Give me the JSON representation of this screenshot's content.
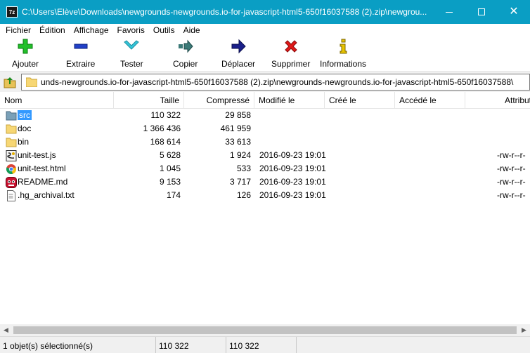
{
  "window": {
    "title": "C:\\Users\\Elève\\Downloads\\newgrounds-newgrounds.io-for-javascript-html5-650f16037588 (2).zip\\newgrou...",
    "app_icon_text": "7z",
    "accent": "#0a9ec4"
  },
  "menu": [
    "Fichier",
    "Édition",
    "Affichage",
    "Favoris",
    "Outils",
    "Aide"
  ],
  "toolbar": [
    {
      "label": "Ajouter",
      "icon": "add-icon"
    },
    {
      "label": "Extraire",
      "icon": "extract-icon"
    },
    {
      "label": "Tester",
      "icon": "test-icon"
    },
    {
      "label": "Copier",
      "icon": "copy-icon"
    },
    {
      "label": "Déplacer",
      "icon": "move-icon"
    },
    {
      "label": "Supprimer",
      "icon": "delete-icon"
    },
    {
      "label": "Informations",
      "icon": "info-icon"
    }
  ],
  "address": {
    "path": "unds-newgrounds.io-for-javascript-html5-650f16037588 (2).zip\\newgrounds-newgrounds.io-for-javascript-html5-650f16037588\\"
  },
  "columns": [
    "Nom",
    "Taille",
    "Compressé",
    "Modifié le",
    "Créé le",
    "Accédé le",
    "Attribut"
  ],
  "files": [
    {
      "name": "src",
      "size": "110 322",
      "packed": "29 858",
      "modified": "",
      "created": "",
      "accessed": "",
      "attr": "",
      "type": "folder-icon",
      "selected": true
    },
    {
      "name": "doc",
      "size": "1 366 436",
      "packed": "461 959",
      "modified": "",
      "created": "",
      "accessed": "",
      "attr": "",
      "type": "folder-icon",
      "selected": false
    },
    {
      "name": "bin",
      "size": "168 614",
      "packed": "33 613",
      "modified": "",
      "created": "",
      "accessed": "",
      "attr": "",
      "type": "folder-icon",
      "selected": false
    },
    {
      "name": "unit-test.js",
      "size": "5 628",
      "packed": "1 924",
      "modified": "2016-09-23 19:01",
      "created": "",
      "accessed": "",
      "attr": "-rw-r--r-",
      "type": "js-file-icon",
      "selected": false
    },
    {
      "name": "unit-test.html",
      "size": "1 045",
      "packed": "533",
      "modified": "2016-09-23 19:01",
      "created": "",
      "accessed": "",
      "attr": "-rw-r--r-",
      "type": "html-file-icon",
      "selected": false
    },
    {
      "name": "README.md",
      "size": "9 153",
      "packed": "3 717",
      "modified": "2016-09-23 19:01",
      "created": "",
      "accessed": "",
      "attr": "-rw-r--r-",
      "type": "md-file-icon",
      "selected": false
    },
    {
      "name": ".hg_archival.txt",
      "size": "174",
      "packed": "126",
      "modified": "2016-09-23 19:01",
      "created": "",
      "accessed": "",
      "attr": "-rw-r--r-",
      "type": "text-file-icon",
      "selected": false
    }
  ],
  "status": {
    "selection": "1 objet(s) sélectionné(s)",
    "size": "110 322",
    "packed": "110 322"
  }
}
